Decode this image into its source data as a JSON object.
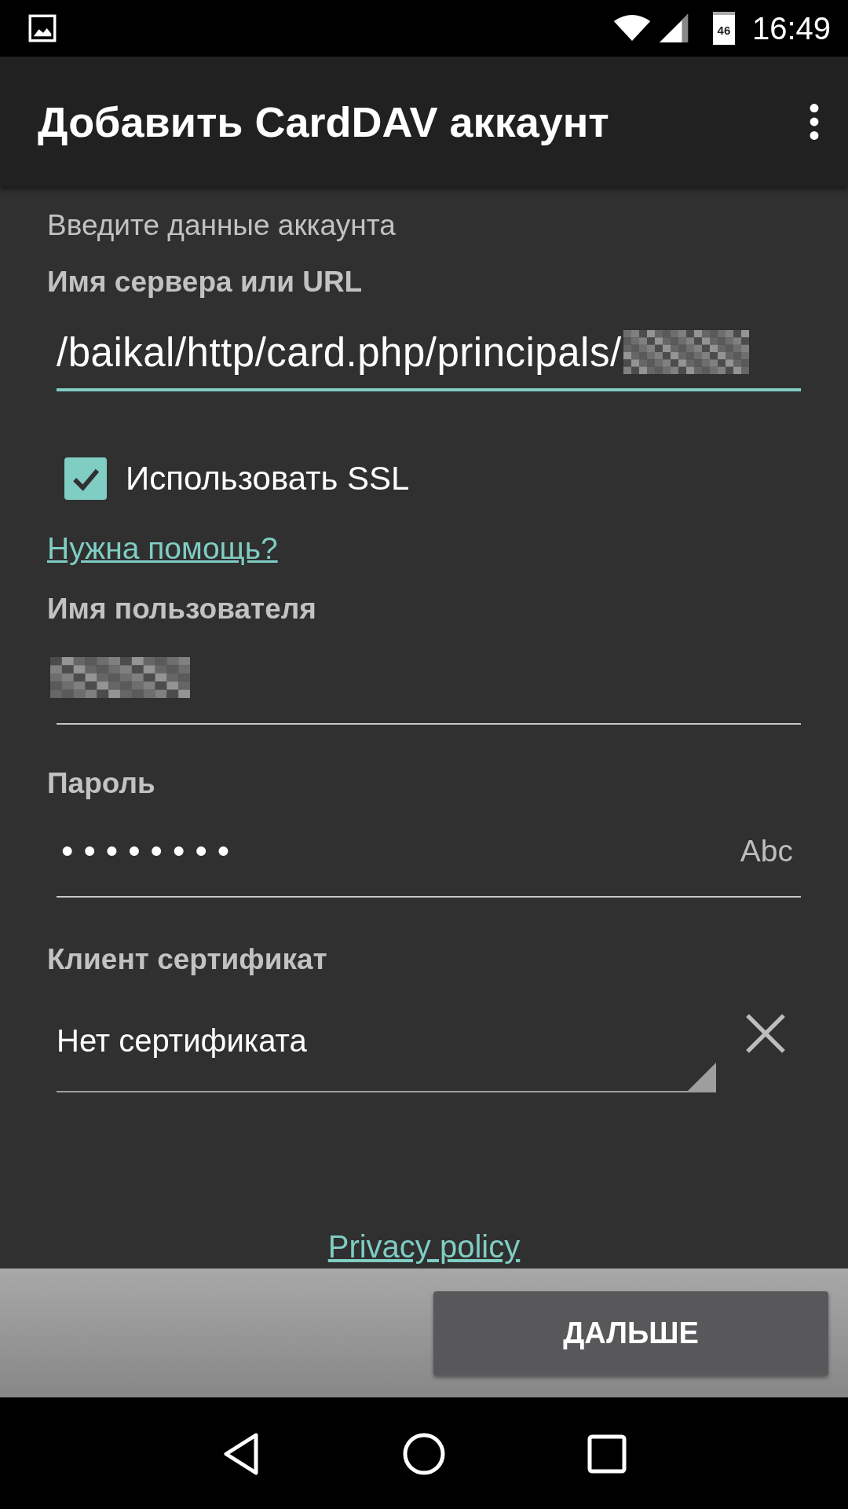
{
  "status_bar": {
    "time": "16:49",
    "battery": "46"
  },
  "app_bar": {
    "title": "Добавить CardDAV аккаунт"
  },
  "form": {
    "intro": "Введите данные аккаунта",
    "server": {
      "label": "Имя сервера или URL",
      "value": "/baikal/http/card.php/principals/",
      "focused": true
    },
    "ssl": {
      "label": "Использовать SSL",
      "checked": true
    },
    "help_link": "Нужна помощь?",
    "username": {
      "label": "Имя пользователя"
    },
    "password": {
      "label": "Пароль",
      "value": "••••••••",
      "toggle": "Abc"
    },
    "certificate": {
      "label": "Клиент сертификат",
      "value": "Нет сертификата"
    },
    "privacy_link": "Privacy policy"
  },
  "next_button": "ДАЛЬШЕ"
}
